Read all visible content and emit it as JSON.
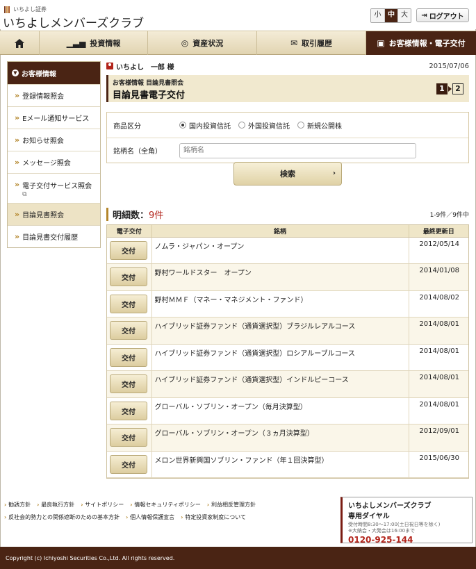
{
  "header": {
    "brand_small": "いちよし証券",
    "brand_main": "いちよしメンバーズクラブ",
    "font_sizes": [
      "小",
      "中",
      "大"
    ],
    "font_size_selected": "中",
    "logout_label": "ログアウト"
  },
  "nav": {
    "home_icon": "home-icon",
    "items": [
      {
        "label": "投資情報",
        "icon": "chart-icon"
      },
      {
        "label": "資産状況",
        "icon": "coins-icon"
      },
      {
        "label": "取引履歴",
        "icon": "handshake-icon"
      },
      {
        "label": "お客様情報・電子交付",
        "icon": "id-card-icon",
        "active": true
      }
    ]
  },
  "sidebar": {
    "title": "お客様情報",
    "items": [
      {
        "label": "登録情報照会"
      },
      {
        "label": "Eメール通知サービス"
      },
      {
        "label": "お知らせ照会"
      },
      {
        "label": "メッセージ照会"
      },
      {
        "label": "電子交付サービス照会",
        "external": "⧉"
      },
      {
        "label": "目論見書照会",
        "active": true
      },
      {
        "label": "目論見書交付履歴"
      }
    ]
  },
  "main": {
    "user_name": "いちよし　一郎 様",
    "date": "2015/07/06",
    "breadcrumb": "お客様情報 目論見書照会",
    "page_title": "目論見書電子交付",
    "steps": [
      "1",
      "2"
    ],
    "current_step": "1",
    "form": {
      "category_label": "商品区分",
      "category_options": [
        "国内投資信託",
        "外国投資信託",
        "新規公開株"
      ],
      "category_selected": "国内投資信託",
      "name_label": "銘柄名（全角）",
      "name_placeholder": "銘柄名",
      "name_value": ""
    },
    "search_label": "検索",
    "results_title": "明細数：",
    "results_count": "9件",
    "results_range": "1-9件／9件中",
    "table": {
      "headers": [
        "電子交付",
        "銘柄",
        "最終更新日"
      ],
      "button_label": "交付",
      "rows": [
        {
          "name": "ノムラ・ジャパン・オープン",
          "date": "2012/05/14"
        },
        {
          "name": "野村ワールドスター　オープン",
          "date": "2014/01/08"
        },
        {
          "name": "野村ＭＭＦ（マネー・マネジメント・ファンド）",
          "date": "2014/08/02"
        },
        {
          "name": "ハイブリッド証券ファンド（通貨選択型）ブラジルレアルコース",
          "date": "2014/08/01"
        },
        {
          "name": "ハイブリッド証券ファンド（通貨選択型）ロシアルーブルコース",
          "date": "2014/08/01"
        },
        {
          "name": "ハイブリッド証券ファンド（通貨選択型）インドルピーコース",
          "date": "2014/08/01"
        },
        {
          "name": "グローバル・ソブリン・オープン（毎月決算型）",
          "date": "2014/08/01"
        },
        {
          "name": "グローバル・ソブリン・オープン（３ヵ月決算型）",
          "date": "2012/09/01"
        },
        {
          "name": "メロン世界新興国ソブリン・ファンド（年１回決算型）",
          "date": "2015/06/30"
        }
      ]
    }
  },
  "footer": {
    "links": [
      "勧誘方針",
      "最良執行方針",
      "サイトポリシー",
      "情報セキュリティポリシー",
      "利益相反管理方針",
      "反社会的勢力との関係遮断のための基本方針",
      "個人情報保護宣言",
      "特定投資家制度について"
    ],
    "dial_title": "いちよしメンバーズクラブ",
    "dial_subtitle": "専用ダイヤル",
    "dial_hours_1": "受付時間8:30～17:00(土日祝日等を除く)",
    "dial_hours_2": "※大納会・大発会は16:00まで",
    "dial_phone": "0120-925-144",
    "copyright": "Copyright (c) Ichiyoshi Securities Co.,Ltd. All rights reserved."
  }
}
